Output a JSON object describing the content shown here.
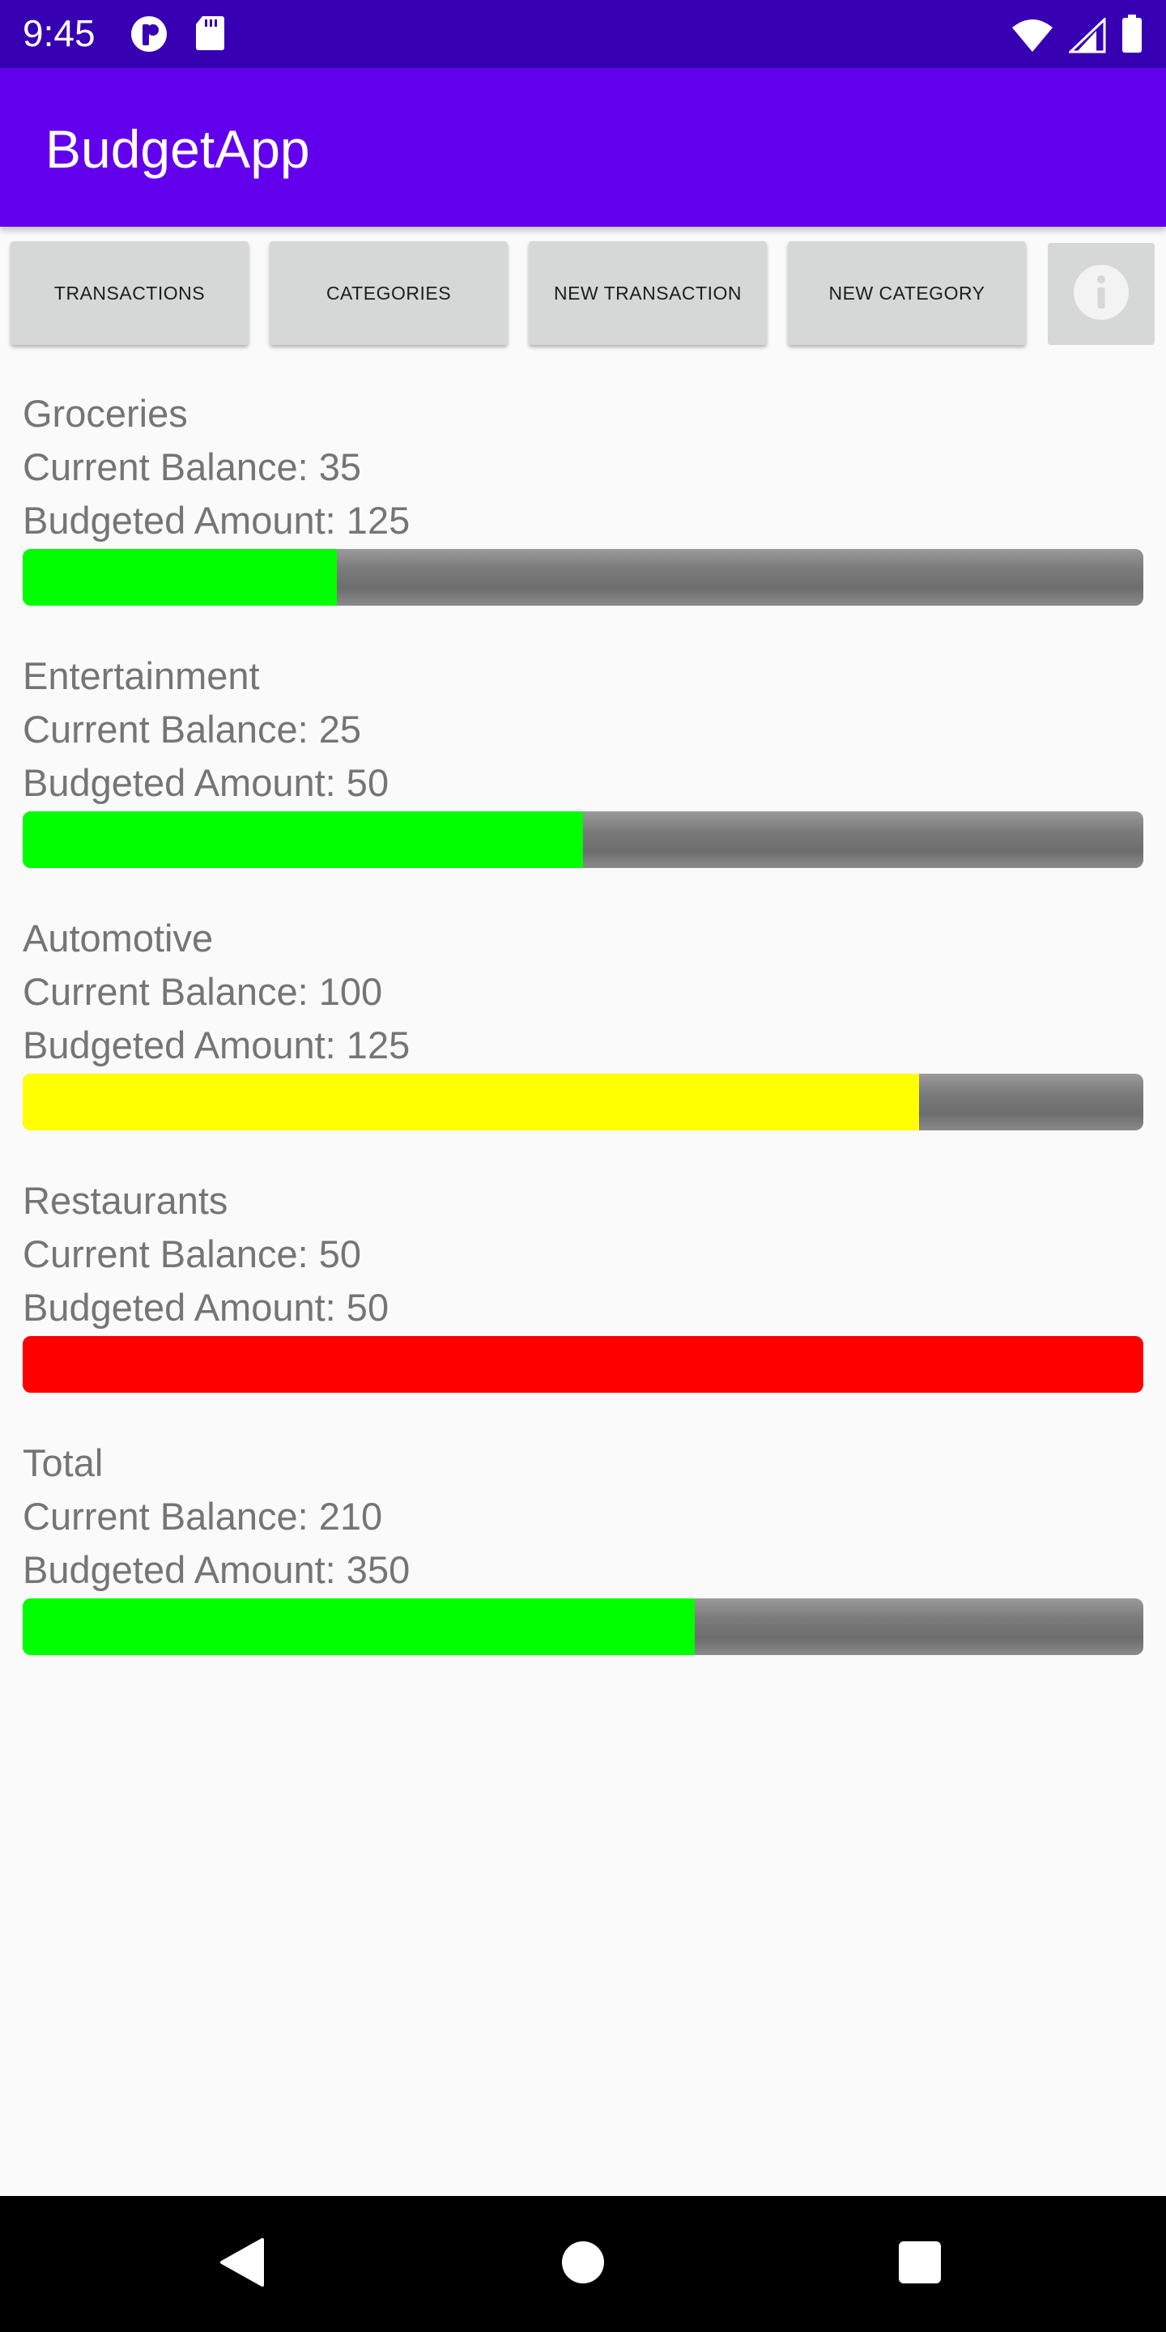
{
  "status_bar": {
    "time": "9:45",
    "left_icons": [
      "app-notification-icon",
      "sd-card-icon"
    ],
    "right_icons": [
      "wifi-icon",
      "cell-signal-icon",
      "battery-icon"
    ]
  },
  "app_bar": {
    "title": "BudgetApp"
  },
  "tabs": [
    {
      "label": "TRANSACTIONS"
    },
    {
      "label": "CATEGORIES"
    },
    {
      "label": "NEW TRANSACTION"
    },
    {
      "label": "NEW CATEGORY"
    }
  ],
  "info_button": {
    "icon": "info-icon"
  },
  "categories": [
    {
      "name": "Groceries",
      "balance_text": "Current Balance: 35",
      "budget_text": "Budgeted Amount: 125",
      "progress": 0.28,
      "color": "#00ff00"
    },
    {
      "name": "Entertainment",
      "balance_text": "Current Balance: 25",
      "budget_text": "Budgeted Amount: 50",
      "progress": 0.5,
      "color": "#00ff00"
    },
    {
      "name": "Automotive",
      "balance_text": "Current Balance: 100",
      "budget_text": "Budgeted Amount: 125",
      "progress": 0.8,
      "color": "#ffff00"
    },
    {
      "name": "Restaurants",
      "balance_text": "Current Balance: 50",
      "budget_text": "Budgeted Amount: 50",
      "progress": 1.0,
      "color": "#ff0000"
    },
    {
      "name": "Total",
      "balance_text": "Current Balance: 210",
      "budget_text": "Budgeted Amount: 350",
      "progress": 0.6,
      "color": "#00ff00"
    }
  ],
  "colors": {
    "status_bar": "#3700b3",
    "app_bar": "#6200ee",
    "under_budget": "#00ff00",
    "near_budget": "#ffff00",
    "over_budget": "#ff0000"
  },
  "nav_bar": {
    "icons": [
      "back-icon",
      "home-icon",
      "recents-icon"
    ]
  }
}
